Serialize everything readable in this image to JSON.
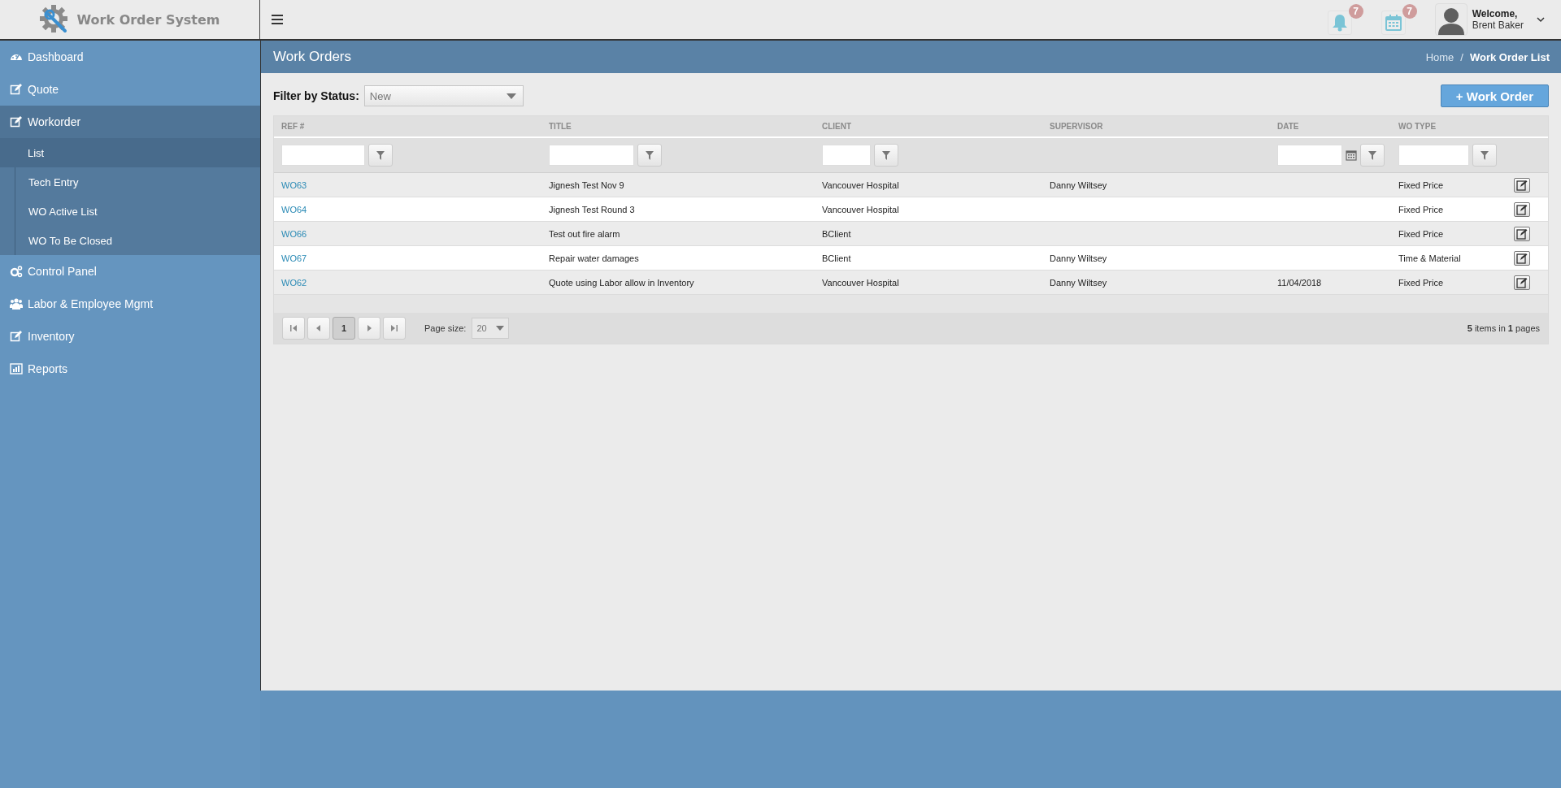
{
  "app": {
    "title": "Work Order System"
  },
  "header": {
    "notifications": {
      "count": "7"
    },
    "calendar": {
      "count": "7"
    },
    "user": {
      "greeting": "Welcome,",
      "name": "Brent Baker"
    }
  },
  "sidebar": {
    "items": [
      {
        "label": "Dashboard",
        "kind": "gauge",
        "selected": false
      },
      {
        "label": "Quote",
        "kind": "edit",
        "selected": false
      },
      {
        "label": "Workorder",
        "kind": "edit",
        "selected": true,
        "expanded": true,
        "children": [
          {
            "label": "List",
            "selected": true
          },
          {
            "label": "Tech Entry",
            "selected": false
          },
          {
            "label": "WO Active List",
            "selected": false
          },
          {
            "label": "WO To Be Closed",
            "selected": false
          }
        ]
      },
      {
        "label": "Control Panel",
        "kind": "gears",
        "selected": false
      },
      {
        "label": "Labor & Employee Mgmt",
        "kind": "users",
        "selected": false
      },
      {
        "label": "Inventory",
        "kind": "edit",
        "selected": false
      },
      {
        "label": "Reports",
        "kind": "chart",
        "selected": false
      }
    ]
  },
  "page": {
    "title": "Work Orders",
    "breadcrumb": {
      "separator": "/",
      "items": [
        {
          "label": "Home",
          "selected": false
        },
        {
          "label": "Work Order List",
          "selected": true
        }
      ]
    }
  },
  "status_filter": {
    "label": "Filter by Status:",
    "value": "New"
  },
  "new_button": {
    "label": "+ Work Order"
  },
  "table": {
    "columns": [
      {
        "label": "REF #",
        "kind": "text"
      },
      {
        "label": "TITLE",
        "kind": "text"
      },
      {
        "label": "CLIENT",
        "kind": "text"
      },
      {
        "label": "SUPERVISOR",
        "kind": "plain"
      },
      {
        "label": "DATE",
        "kind": "date"
      },
      {
        "label": "WO TYPE",
        "kind": "text"
      }
    ],
    "rows": [
      {
        "ref": "WO63",
        "title": "Jignesh Test Nov 9",
        "client": "Vancouver Hospital",
        "supervisor": "Danny Wiltsey",
        "date": "",
        "wo_type": "Fixed Price"
      },
      {
        "ref": "WO64",
        "title": "Jignesh Test Round 3",
        "client": "Vancouver Hospital",
        "supervisor": "",
        "date": "",
        "wo_type": "Fixed Price"
      },
      {
        "ref": "WO66",
        "title": "Test out fire alarm",
        "client": "BClient",
        "supervisor": "",
        "date": "",
        "wo_type": "Fixed Price"
      },
      {
        "ref": "WO67",
        "title": "Repair water damages",
        "client": "BClient",
        "supervisor": "Danny Wiltsey",
        "date": "",
        "wo_type": "Time & Material"
      },
      {
        "ref": "WO62",
        "title": "Quote using Labor allow in Inventory",
        "client": "Vancouver Hospital",
        "supervisor": "Danny Wiltsey",
        "date": "11/04/2018",
        "wo_type": "Fixed Price"
      }
    ]
  },
  "pager": {
    "pages": [
      {
        "label": "1",
        "selected": true
      }
    ],
    "page_size_label": "Page size:",
    "page_size": "20",
    "summary": "**5** items in **1** pages"
  }
}
